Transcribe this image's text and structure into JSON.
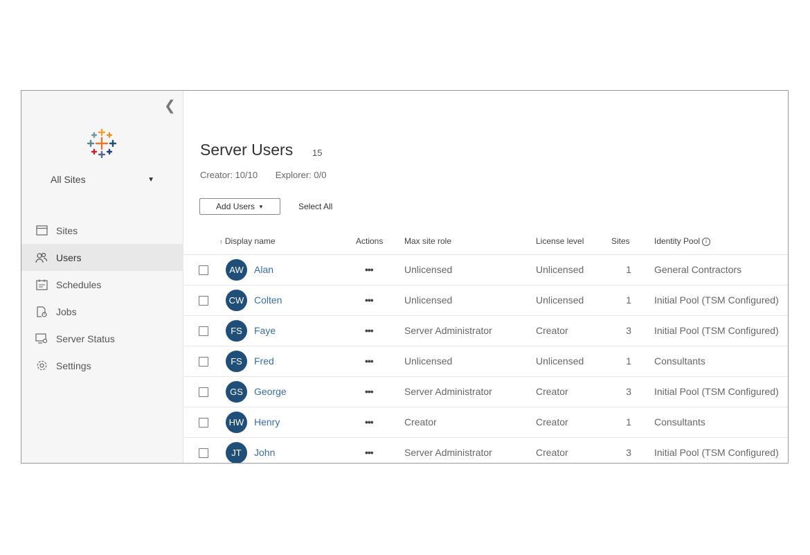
{
  "sidebar": {
    "site_selector": "All Sites",
    "items": [
      {
        "label": "Sites",
        "icon": "sites-icon",
        "active": false
      },
      {
        "label": "Users",
        "icon": "users-icon",
        "active": true
      },
      {
        "label": "Schedules",
        "icon": "calendar-icon",
        "active": false
      },
      {
        "label": "Jobs",
        "icon": "jobs-icon",
        "active": false
      },
      {
        "label": "Server Status",
        "icon": "server-status-icon",
        "active": false
      },
      {
        "label": "Settings",
        "icon": "gear-icon",
        "active": false
      }
    ]
  },
  "header": {
    "title": "Server Users",
    "count": "15",
    "licenses": [
      "Creator: 10/10",
      "Explorer: 0/0"
    ]
  },
  "toolbar": {
    "add_users_label": "Add Users",
    "select_all_label": "Select All"
  },
  "table": {
    "sort_indicator": "↑",
    "columns": [
      "Display name",
      "Actions",
      "Max site role",
      "License level",
      "Sites",
      "Identity Pool"
    ],
    "actions_glyph": "•••",
    "rows": [
      {
        "initials": "AW",
        "name": "Alan",
        "role": "Unlicensed",
        "license": "Unlicensed",
        "sites": "1",
        "pool": "General Contractors"
      },
      {
        "initials": "CW",
        "name": "Colten",
        "role": "Unlicensed",
        "license": "Unlicensed",
        "sites": "1",
        "pool": "Initial Pool (TSM Configured)"
      },
      {
        "initials": "FS",
        "name": "Faye",
        "role": "Server Administrator",
        "license": "Creator",
        "sites": "3",
        "pool": "Initial Pool (TSM Configured)"
      },
      {
        "initials": "FS",
        "name": "Fred",
        "role": "Unlicensed",
        "license": "Unlicensed",
        "sites": "1",
        "pool": "Consultants"
      },
      {
        "initials": "GS",
        "name": "George",
        "role": "Server Administrator",
        "license": "Creator",
        "sites": "3",
        "pool": "Initial Pool (TSM Configured)"
      },
      {
        "initials": "HW",
        "name": "Henry",
        "role": "Creator",
        "license": "Creator",
        "sites": "1",
        "pool": "Consultants"
      },
      {
        "initials": "JT",
        "name": "John",
        "role": "Server Administrator",
        "license": "Creator",
        "sites": "3",
        "pool": "Initial Pool (TSM Configured)"
      }
    ]
  },
  "colors": {
    "avatar": "#1f4e79",
    "link": "#3a6ea5",
    "sidebar_bg": "#f6f6f6"
  }
}
